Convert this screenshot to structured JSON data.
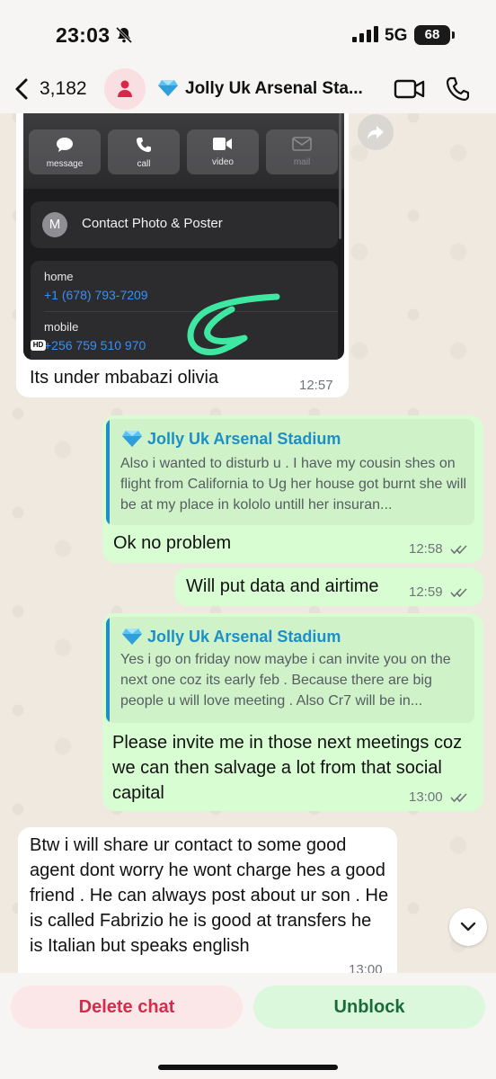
{
  "status_bar": {
    "time": "23:03",
    "network": "5G",
    "battery": "68"
  },
  "header": {
    "back_count": "3,182",
    "title": "Jolly Uk Arsenal Sta..."
  },
  "messages": {
    "m1": {
      "screenshot": {
        "actions": [
          "message",
          "call",
          "video",
          "mail"
        ],
        "contact_initial": "M",
        "contact_photo_label": "Contact Photo & Poster",
        "phones": [
          {
            "label": "home",
            "number": "+1 (678) 793-7209"
          },
          {
            "label": "mobile",
            "number": "+256 759 510 970"
          }
        ],
        "hd_badge": "HD"
      },
      "text": "Its under mbabazi olivia",
      "time": "12:57"
    },
    "m2": {
      "quote_name": "Jolly Uk Arsenal Stadium",
      "quote_text": "Also i wanted to disturb u . I have my cousin shes on flight from California to Ug her house got burnt she will be at my place in kololo untill her insuran...",
      "text": "Ok no problem",
      "time": "12:58"
    },
    "m3": {
      "text": "Will put data and airtime",
      "time": "12:59"
    },
    "m4": {
      "quote_name": "Jolly Uk Arsenal Stadium",
      "quote_text": "Yes i go on friday now maybe i can invite you on the next one coz its early feb . Because there are big people u will love meeting . Also Cr7 will be in...",
      "text": "Please invite me in those next meetings coz we can then salvage a lot from that social capital",
      "time": "13:00"
    },
    "m5": {
      "text": "Btw i will share ur contact to some good agent dont worry he wont charge hes a good friend . He can always post about ur son . He is called Fabrizio he is good at transfers he is Italian but speaks english",
      "time": "13:00"
    }
  },
  "bottom_bar": {
    "delete_label": "Delete chat",
    "unblock_label": "Unblock"
  },
  "colors": {
    "incoming": "#ffffff",
    "outgoing": "#d9fdd3",
    "quote_accent": "#1d8fc6",
    "delete": "#d12d4c",
    "unblock": "#1b6b3a",
    "tick": "#6f7478"
  }
}
